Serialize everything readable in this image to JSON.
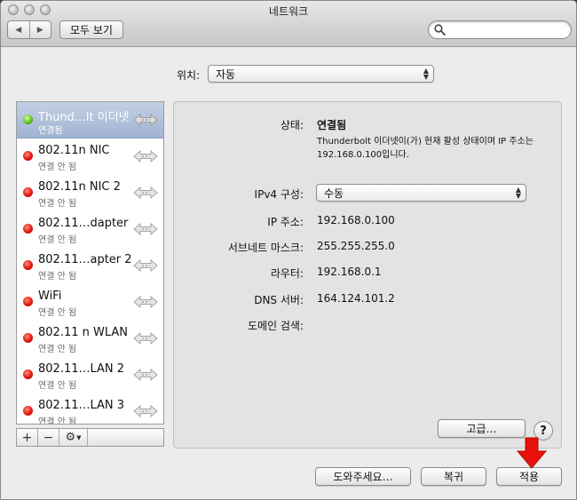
{
  "window": {
    "title": "네트워크"
  },
  "toolbar": {
    "back_label": "◀",
    "forward_label": "▶",
    "show_all_label": "모두 보기",
    "search_value": "",
    "search_placeholder": ""
  },
  "location": {
    "label": "위치:",
    "value": "자동"
  },
  "services": [
    {
      "name": "Thund…lt 이더넷",
      "status": "연결됨",
      "state": "connected",
      "selected": true
    },
    {
      "name": "802.11n NIC",
      "status": "연결 안 됨",
      "state": "disconnected"
    },
    {
      "name": "802.11n NIC 2",
      "status": "연결 안 됨",
      "state": "disconnected"
    },
    {
      "name": "802.11…dapter",
      "status": "연결 안 됨",
      "state": "disconnected"
    },
    {
      "name": "802.11…apter 2",
      "status": "연결 안 됨",
      "state": "disconnected"
    },
    {
      "name": "WiFi",
      "status": "연결 안 됨",
      "state": "disconnected"
    },
    {
      "name": "802.11 n WLAN",
      "status": "연결 안 됨",
      "state": "disconnected"
    },
    {
      "name": "802.11…LAN 2",
      "status": "연결 안 됨",
      "state": "disconnected"
    },
    {
      "name": "802.11…LAN 3",
      "status": "연결 안 됨",
      "state": "disconnected"
    }
  ],
  "sidebar_tools": {
    "add": "+",
    "remove": "−"
  },
  "detail": {
    "status_label": "상태:",
    "status_value": "연결됨",
    "status_description": "Thunderbolt 이더넷이(가) 현재 활성 상태이며 IP 주소는 192.168.0.100입니다.",
    "ipv4_label": "IPv4 구성:",
    "ipv4_value": "수동",
    "ip_label": "IP 주소:",
    "ip_value": "192.168.0.100",
    "subnet_label": "서브네트 마스크:",
    "subnet_value": "255.255.255.0",
    "router_label": "라우터:",
    "router_value": "192.168.0.1",
    "dns_label": "DNS 서버:",
    "dns_value": "164.124.101.2",
    "domain_label": "도메인 검색:",
    "domain_value": "",
    "advanced_label": "고급…",
    "help_label": "?"
  },
  "buttons": {
    "assist": "도와주세요…",
    "revert": "복귀",
    "apply": "적용"
  },
  "colors": {
    "selection": "#a9bcd9",
    "connected": "#5ec224",
    "disconnected": "#e2170e",
    "pointer": "#e8120c"
  },
  "icons": {
    "search": "magnifier-icon",
    "gear": "gear-icon",
    "network": "network-arrows-icon",
    "pointer": "red-arrow-icon"
  }
}
